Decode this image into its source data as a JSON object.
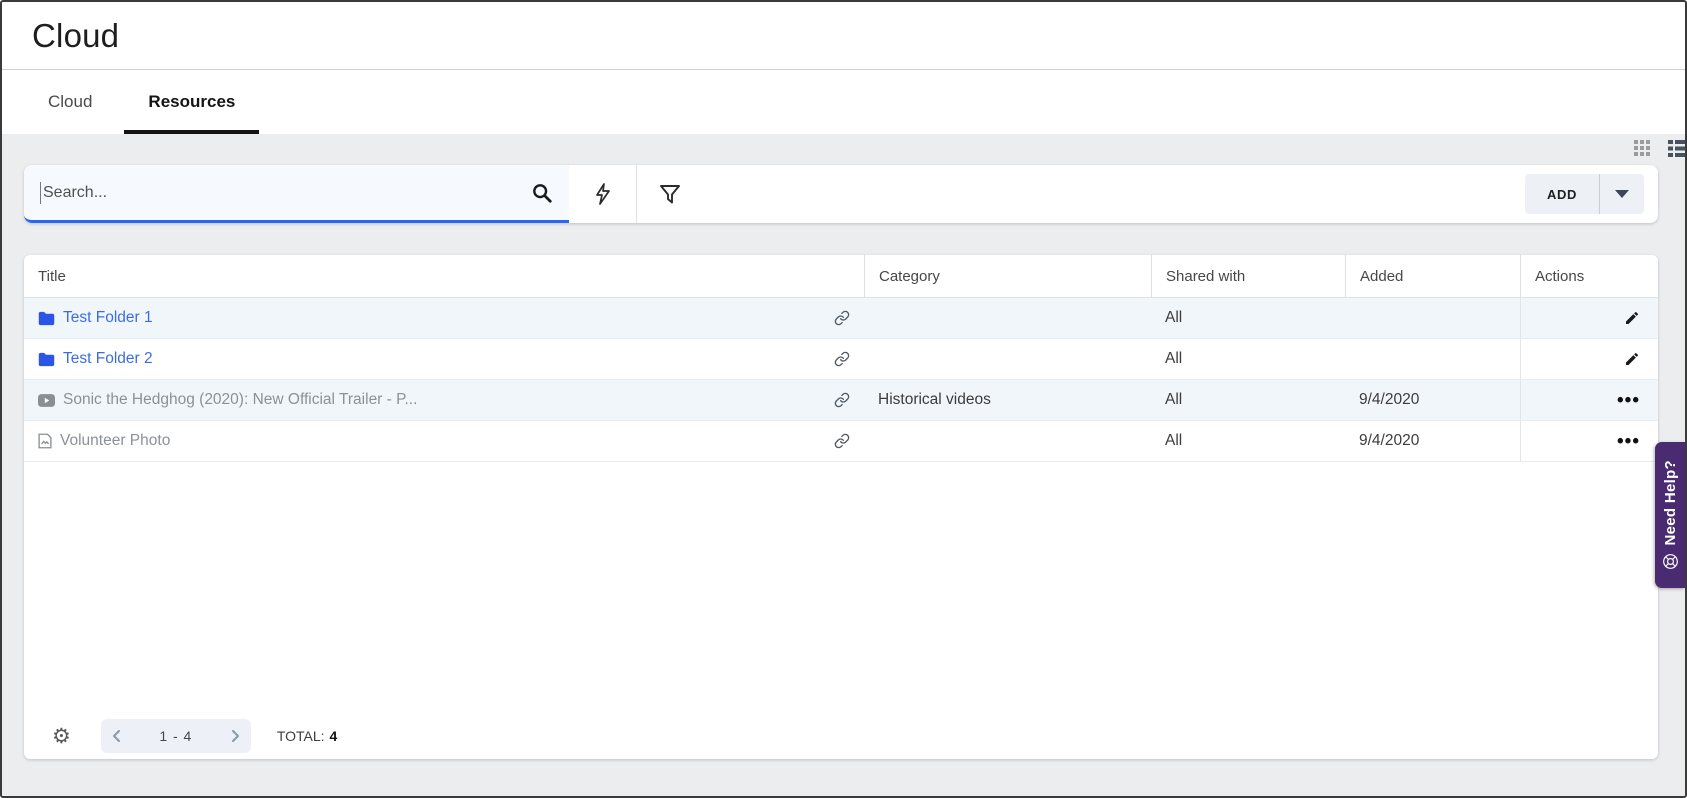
{
  "page": {
    "title": "Cloud"
  },
  "tabs": [
    {
      "label": "Cloud",
      "active": false
    },
    {
      "label": "Resources",
      "active": true
    }
  ],
  "toolbar": {
    "search_placeholder": "Search...",
    "add_label": "ADD"
  },
  "icons": {
    "settings_glyph": "⚙",
    "more_glyph": "•••"
  },
  "colors": {
    "accent_blue": "#2a66f5",
    "link_blue": "#3a6ce4",
    "folder_blue": "#2b55e6",
    "annotation_red": "#ee4149",
    "help_purple": "#4a2a70",
    "row_alt": "#f1f6fb"
  },
  "table": {
    "columns": [
      "Title",
      "Category",
      "Shared with",
      "Added",
      "Actions"
    ],
    "rows": [
      {
        "title": "Test Folder 1",
        "type": "folder",
        "category": "",
        "shared_with": "All",
        "added": "",
        "action": "edit"
      },
      {
        "title": "Test Folder 2",
        "type": "folder",
        "category": "",
        "shared_with": "All",
        "added": "",
        "action": "edit"
      },
      {
        "title": "Sonic the Hedghog (2020): New Official Trailer - P...",
        "type": "video",
        "category": "Historical videos",
        "shared_with": "All",
        "added": "9/4/2020",
        "action": "more"
      },
      {
        "title": "Volunteer Photo",
        "type": "image",
        "category": "",
        "shared_with": "All",
        "added": "9/4/2020",
        "action": "more"
      }
    ]
  },
  "footer": {
    "page_range": "1 - 4",
    "total_label": "TOTAL:",
    "total_value": "4"
  },
  "help_tab": {
    "label": "Need Help?"
  }
}
